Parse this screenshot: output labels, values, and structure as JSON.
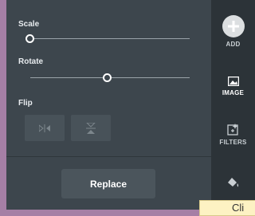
{
  "controls": {
    "scale_label": "Scale",
    "scale_value": 0,
    "rotate_label": "Rotate",
    "rotate_value": 0.5,
    "flip_label": "Flip"
  },
  "replace_label": "Replace",
  "rail": {
    "add": "ADD",
    "image": "IMAGE",
    "filters": "FILTERS"
  },
  "tooltip": "Cli",
  "colors": {
    "panel": "#3d464d",
    "rail": "#2c3338",
    "frame": "#a57fa5",
    "tooltip": "#fdf2c3"
  },
  "icons": [
    "flip-horizontal-icon",
    "flip-vertical-icon",
    "plus-icon",
    "image-icon",
    "filters-icon",
    "fill-icon"
  ]
}
